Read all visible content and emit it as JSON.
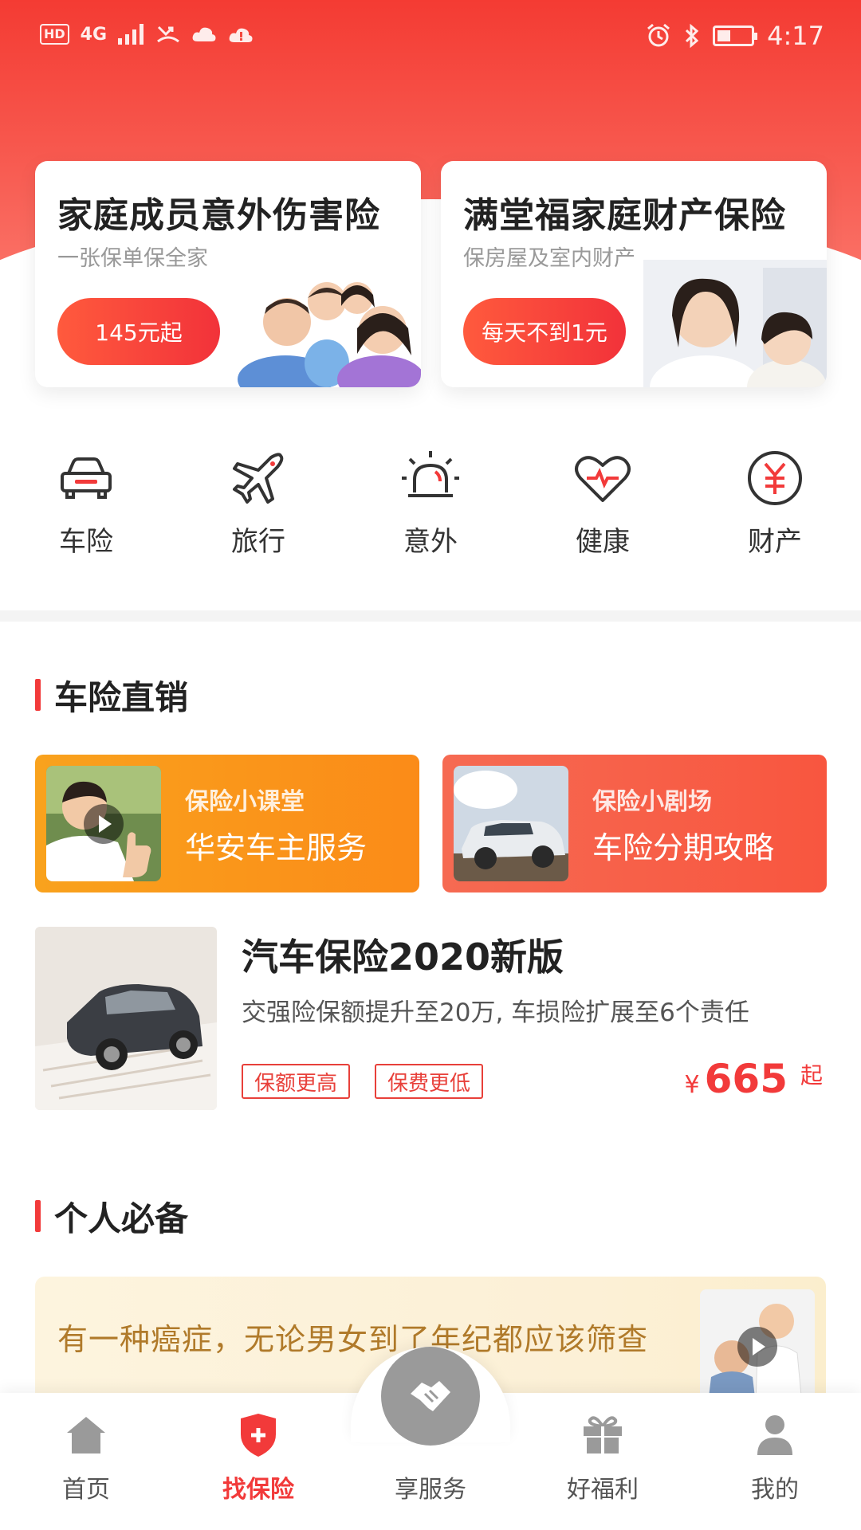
{
  "status_bar": {
    "hd": "HD",
    "network": "4G",
    "time": "4:17"
  },
  "promos": [
    {
      "title": "家庭成员意外伤害险",
      "subtitle": "一张保单保全家",
      "button": "145元起"
    },
    {
      "title": "满堂福家庭财产保险",
      "subtitle": "保房屋及室内财产",
      "button": "每天不到1元"
    }
  ],
  "categories": [
    {
      "label": "车险",
      "icon": "car-icon"
    },
    {
      "label": "旅行",
      "icon": "airplane-icon"
    },
    {
      "label": "意外",
      "icon": "alarm-light-icon"
    },
    {
      "label": "健康",
      "icon": "heart-pulse-icon"
    },
    {
      "label": "财产",
      "icon": "yuan-icon"
    }
  ],
  "section_car": {
    "title": "车险直销",
    "videos": [
      {
        "tag": "保险小课堂",
        "title": "华安车主服务"
      },
      {
        "tag": "保险小剧场",
        "title": "车险分期攻略"
      }
    ],
    "product": {
      "title": "汽车保险2020新版",
      "description": "交强险保额提升至20万, 车损险扩展至6个责任",
      "tags": [
        "保额更高",
        "保费更低"
      ],
      "currency": "¥",
      "price": "665",
      "price_suffix": "起"
    }
  },
  "section_personal": {
    "title": "个人必备",
    "banner_text": "有一种癌症，无论男女到了年纪都应该筛查"
  },
  "bottom_nav": [
    {
      "label": "首页",
      "icon": "home-icon"
    },
    {
      "label": "找保险",
      "icon": "shield-plus-icon",
      "active": true
    },
    {
      "label": "享服务",
      "icon": "handshake-icon"
    },
    {
      "label": "好福利",
      "icon": "gift-icon"
    },
    {
      "label": "我的",
      "icon": "user-icon"
    }
  ],
  "colors": {
    "brand_red": "#f23a3a",
    "orange": "#f9a21d",
    "gold_text": "#b07a2a"
  }
}
